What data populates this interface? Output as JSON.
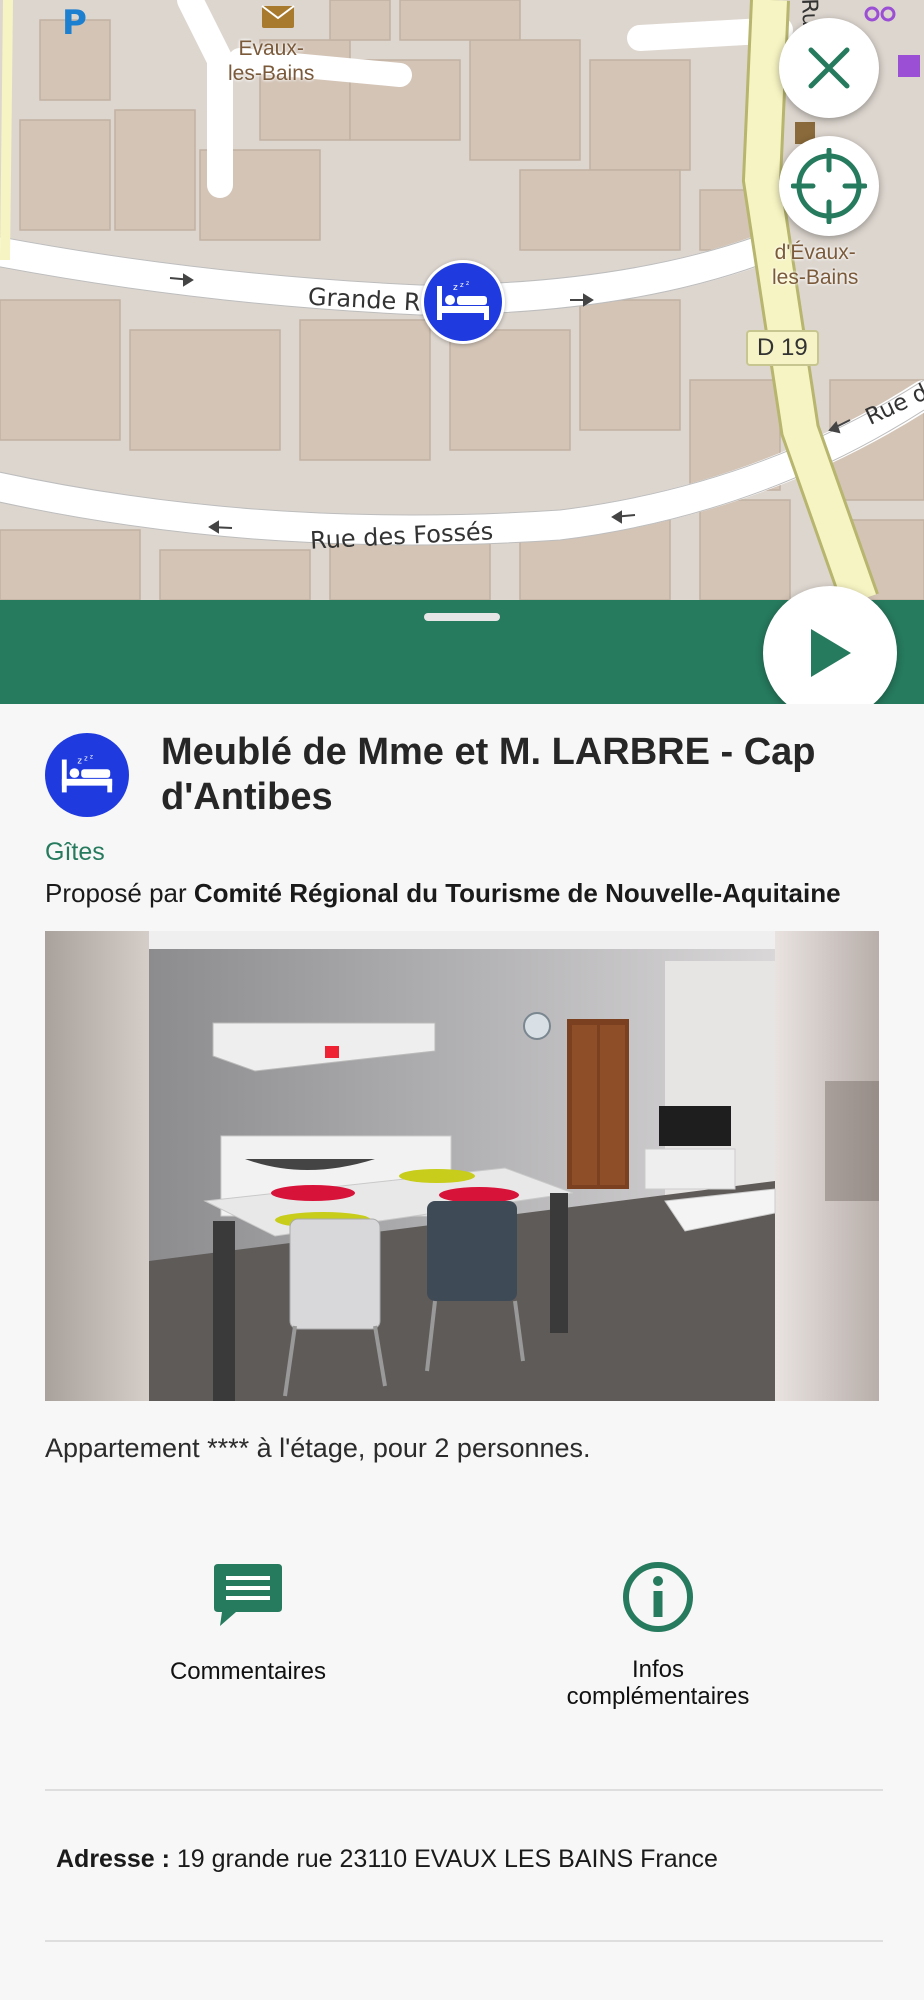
{
  "map": {
    "town_label": "Evaux-\nles-Bains",
    "town_label_right": "d'Évaux-\nles-Bains",
    "street_grande_rue": "Grande Rue",
    "street_fosses": "Rue des Fossés",
    "street_right": "Rue d",
    "street_top": "Ru",
    "road_badge": "D 19",
    "parking_label": "P",
    "close_icon": "close-x-icon",
    "locate_icon": "crosshair-icon",
    "marker_icon": "bed-icon",
    "accent_color": "#267a5e",
    "marker_color": "#1f3be0"
  },
  "sheet": {
    "play_icon": "play-icon",
    "bar_color": "#267a5e"
  },
  "poi": {
    "title": "Meublé de Mme et M. LARBRE - Cap d'Antibes",
    "category": "Gîtes",
    "provider_prefix": "Proposé par ",
    "provider_name": "Comité Régional du Tourisme de Nouvelle-Aquitaine",
    "photo_alt": "Salle à manger meublée",
    "description": "Appartement **** à l'étage, pour 2 personnes."
  },
  "actions": {
    "comments_label": "Commentaires",
    "info_label_line1": "Infos",
    "info_label_line2": "complémentaires"
  },
  "address": {
    "label": "Adresse : ",
    "value": "19 grande rue 23110 EVAUX LES BAINS France"
  }
}
